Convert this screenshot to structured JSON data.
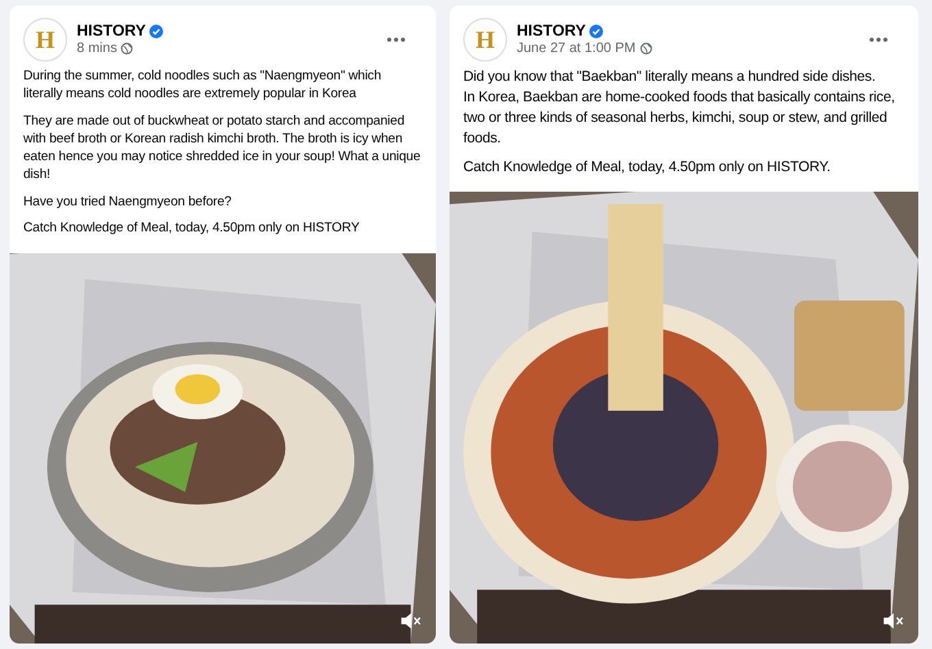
{
  "posts": [
    {
      "page_name": "HISTORY",
      "logo": "H",
      "verified": true,
      "time": "8 mins",
      "paragraphs": [
        "During the summer, cold noodles such as \"Naengmyeon\" which literally means cold noodles are extremely popular in Korea",
        "They are made out of buckwheat or potato starch and accompanied with beef broth or Korean radish kimchi broth. The broth is icy when eaten hence you may notice shredded ice in your soup! What a unique dish!",
        "Have you tried Naengmyeon before?",
        "Catch Knowledge of Meal, today, 4.50pm only on HISTORY"
      ],
      "media": {
        "kind": "picture",
        "muted": true
      }
    },
    {
      "page_name": "HISTORY",
      "logo": "H",
      "verified": true,
      "time": "June 27 at 1:00 PM",
      "paragraphs": [
        "Did you know that \"Baekban\" literally means a hundred side dishes.\nIn Korea, Baekban are home-cooked foods that basically contains rice, two or three kinds of seasonal herbs, kimchi, soup or stew, and grilled foods.",
        "Catch Knowledge of Meal, today, 4.50pm only on HISTORY."
      ],
      "media": {
        "kind": "picture",
        "muted": true
      }
    }
  ]
}
